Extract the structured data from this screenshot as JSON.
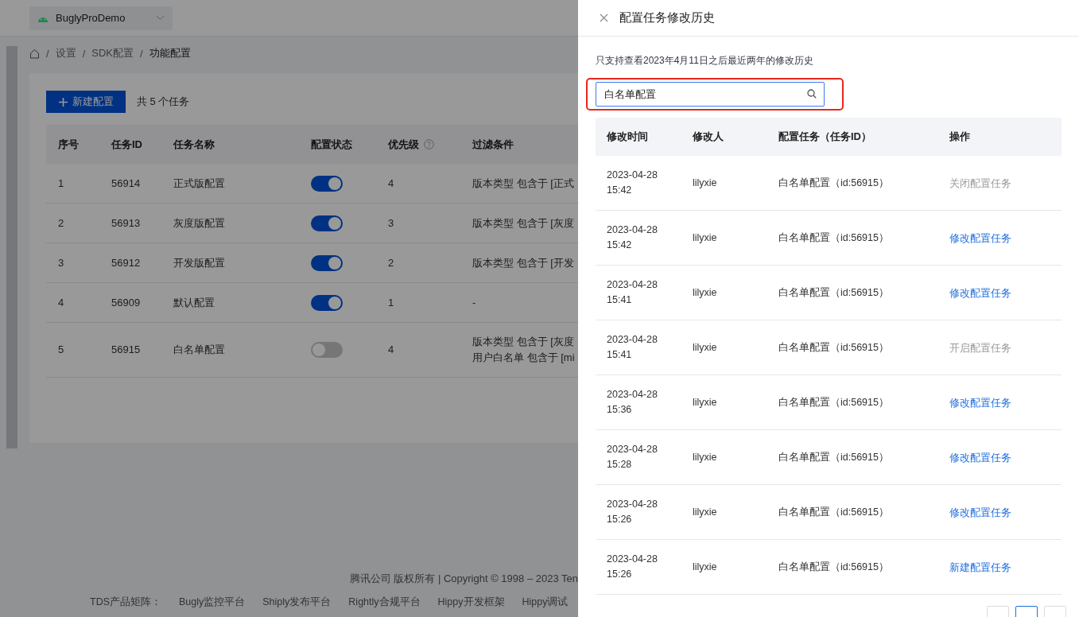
{
  "app_select": {
    "value": "BuglyProDemo"
  },
  "breadcrumb": [
    {
      "separator": "/",
      "label": "设置"
    },
    {
      "separator": "/",
      "label": "SDK配置"
    },
    {
      "separator": "/",
      "label": "功能配置"
    }
  ],
  "toolbar": {
    "new_button": "新建配置",
    "count": "共 5 个任务"
  },
  "table": {
    "columns": [
      "序号",
      "任务ID",
      "任务名称",
      "配置状态",
      "优先级",
      "过滤条件"
    ],
    "rows": [
      {
        "index": "1",
        "id": "56914",
        "name": "正式版配置",
        "on": true,
        "priority": "4",
        "filters": [
          "版本类型 包含于 [正式"
        ]
      },
      {
        "index": "2",
        "id": "56913",
        "name": "灰度版配置",
        "on": true,
        "priority": "3",
        "filters": [
          "版本类型 包含于 [灰度"
        ]
      },
      {
        "index": "3",
        "id": "56912",
        "name": "开发版配置",
        "on": true,
        "priority": "2",
        "filters": [
          "版本类型 包含于 [开发"
        ]
      },
      {
        "index": "4",
        "id": "56909",
        "name": "默认配置",
        "on": true,
        "priority": "1",
        "filters": [
          "-"
        ]
      },
      {
        "index": "5",
        "id": "56915",
        "name": "白名单配置",
        "on": false,
        "priority": "4",
        "filters": [
          "版本类型 包含于 [灰度",
          "用户白名单 包含于 [mi"
        ]
      }
    ]
  },
  "footer": {
    "copyright": "腾讯公司 版权所有 | Copyright © 1998 – 2023 Ten",
    "matrix_label": "TDS产品矩阵：",
    "links": [
      "Bugly监控平台",
      "Shiply发布平台",
      "Rightly合规平台",
      "Hippy开发框架",
      "Hippy调试"
    ]
  },
  "drawer": {
    "title": "配置任务修改历史",
    "note": "只支持查看2023年4月11日之后最近两年的修改历史",
    "search": {
      "value": "白名单配置"
    },
    "columns": [
      "修改时间",
      "修改人",
      "配置任务（任务ID）",
      "操作"
    ],
    "rows": [
      {
        "date": "2023-04-28",
        "time": "15:42",
        "user": "lilyxie",
        "task": "白名单配置（id:56915）",
        "action": "关闭配置任务",
        "disabled": true
      },
      {
        "date": "2023-04-28",
        "time": "15:42",
        "user": "lilyxie",
        "task": "白名单配置（id:56915）",
        "action": "修改配置任务",
        "disabled": false
      },
      {
        "date": "2023-04-28",
        "time": "15:41",
        "user": "lilyxie",
        "task": "白名单配置（id:56915）",
        "action": "修改配置任务",
        "disabled": false
      },
      {
        "date": "2023-04-28",
        "time": "15:41",
        "user": "lilyxie",
        "task": "白名单配置（id:56915）",
        "action": "开启配置任务",
        "disabled": true
      },
      {
        "date": "2023-04-28",
        "time": "15:36",
        "user": "lilyxie",
        "task": "白名单配置（id:56915）",
        "action": "修改配置任务",
        "disabled": false
      },
      {
        "date": "2023-04-28",
        "time": "15:28",
        "user": "lilyxie",
        "task": "白名单配置（id:56915）",
        "action": "修改配置任务",
        "disabled": false
      },
      {
        "date": "2023-04-28",
        "time": "15:26",
        "user": "lilyxie",
        "task": "白名单配置（id:56915）",
        "action": "修改配置任务",
        "disabled": false
      },
      {
        "date": "2023-04-28",
        "time": "15:26",
        "user": "lilyxie",
        "task": "白名单配置（id:56915）",
        "action": "新建配置任务",
        "disabled": false
      }
    ],
    "pagination": [
      {
        "kind": "prev"
      },
      {
        "kind": "page",
        "selected": true
      },
      {
        "kind": "next"
      }
    ]
  }
}
